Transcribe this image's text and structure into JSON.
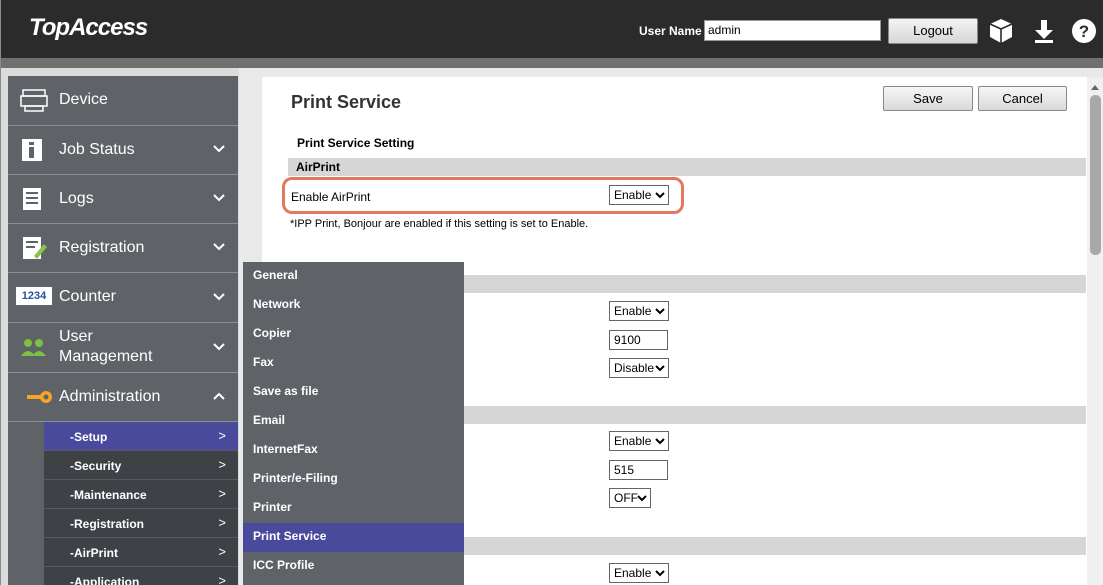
{
  "header": {
    "logo_text": "TopAccess",
    "user_name_label": "User Name",
    "user_name_value": "admin",
    "logout_label": "Logout",
    "icons": [
      "cube-icon",
      "download-icon",
      "help-icon"
    ]
  },
  "sidebar": {
    "items": [
      {
        "label": "Device",
        "icon": "device-icon",
        "chevron": "none"
      },
      {
        "label": "Job Status",
        "icon": "info-icon",
        "chevron": "down"
      },
      {
        "label": "Logs",
        "icon": "logs-icon",
        "chevron": "down"
      },
      {
        "label": "Registration",
        "icon": "registration-icon",
        "chevron": "down"
      },
      {
        "label": "Counter",
        "icon": "counter-icon",
        "icon_text": "1234",
        "chevron": "down"
      },
      {
        "label": "User Management",
        "label_line1": "User",
        "label_line2": "Management",
        "icon": "users-icon",
        "chevron": "down"
      },
      {
        "label": "Administration",
        "icon": "key-icon",
        "chevron": "up"
      }
    ],
    "admin_sub_items": [
      {
        "label": "-Setup",
        "arrow": ">",
        "active": true
      },
      {
        "label": "-Security",
        "arrow": ">"
      },
      {
        "label": "-Maintenance",
        "arrow": ">"
      },
      {
        "label": "-Registration",
        "arrow": ">"
      },
      {
        "label": "-AirPrint",
        "arrow": ">"
      },
      {
        "label": "-Application",
        "arrow": ">"
      }
    ]
  },
  "flyout": {
    "items": [
      {
        "label": "General"
      },
      {
        "label": "Network"
      },
      {
        "label": "Copier"
      },
      {
        "label": "Fax"
      },
      {
        "label": "Save as file"
      },
      {
        "label": "Email"
      },
      {
        "label": "InternetFax"
      },
      {
        "label": "Printer/e-Filing"
      },
      {
        "label": "Printer"
      },
      {
        "label": "Print Service",
        "active": true
      },
      {
        "label": "ICC Profile"
      }
    ]
  },
  "main": {
    "title": "Print Service",
    "save_label": "Save",
    "cancel_label": "Cancel",
    "section_title": "Print Service Setting",
    "airprint": {
      "group_label": "AirPrint",
      "enable_label": "Enable AirPrint",
      "enable_value": "Enable",
      "note": "*IPP Print, Bonjour are enabled if this setting is set to Enable."
    },
    "group2": {
      "select1": "Enable",
      "port": "9100",
      "select2": "Disable"
    },
    "group3": {
      "select1": "Enable",
      "port": "515",
      "select2": "OFF"
    },
    "group4": {
      "select1": "Enable"
    }
  },
  "colors": {
    "header_bg": "#2b2b2b",
    "sidebar_bg": "#5f6368",
    "sub_bg": "#3e4247",
    "active_bg": "#4a4a9c",
    "highlight": "#e5775f",
    "group_bar": "#d6d6d6"
  }
}
